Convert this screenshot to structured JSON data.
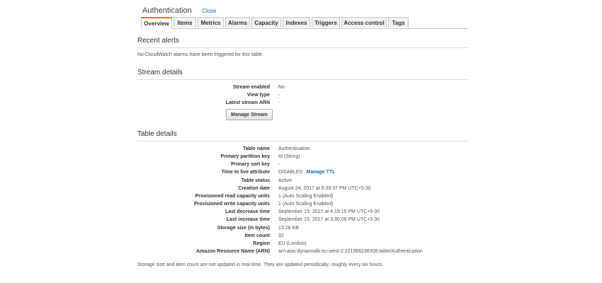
{
  "header": {
    "title": "Authentication",
    "close_label": "Close"
  },
  "tabs": [
    {
      "label": "Overview"
    },
    {
      "label": "Items"
    },
    {
      "label": "Metrics"
    },
    {
      "label": "Alarms"
    },
    {
      "label": "Capacity"
    },
    {
      "label": "Indexes"
    },
    {
      "label": "Triggers"
    },
    {
      "label": "Access control"
    },
    {
      "label": "Tags"
    }
  ],
  "recent_alerts": {
    "title": "Recent alerts",
    "message": "No CloudWatch alarms have been triggered for this table."
  },
  "stream_details": {
    "title": "Stream details",
    "rows": [
      {
        "label": "Stream enabled",
        "value": "No"
      },
      {
        "label": "View type",
        "value": "-"
      },
      {
        "label": "Latest stream ARN",
        "value": "-"
      }
    ],
    "manage_button": "Manage Stream"
  },
  "table_details": {
    "title": "Table details",
    "rows": [
      {
        "label": "Table name",
        "value": "Authentication"
      },
      {
        "label": "Primary partition key",
        "value": "Id (String)"
      },
      {
        "label": "Primary sort key",
        "value": "-"
      },
      {
        "label": "Time to live attribute",
        "value": "DISABLED",
        "link": "Manage TTL"
      },
      {
        "label": "Table status",
        "value": "Active"
      },
      {
        "label": "Creation date",
        "value": "August 24, 2017 at 6:39:37 PM UTC+5:30"
      },
      {
        "label": "Provisioned read capacity units",
        "value": "1 (Auto Scaling Enabled)"
      },
      {
        "label": "Provisioned write capacity units",
        "value": "1 (Auto Scaling Enabled)"
      },
      {
        "label": "Last decrease time",
        "value": "September 15, 2017 at 4:19:15 PM UTC+5:30"
      },
      {
        "label": "Last increase time",
        "value": "September 15, 2017 at 3:30:09 PM UTC+5:30"
      },
      {
        "label": "Storage size (in bytes)",
        "value": "13.28 KB"
      },
      {
        "label": "Item count",
        "value": "32"
      },
      {
        "label": "Region",
        "value": "EU (London)"
      },
      {
        "label": "Amazon Resource Name (ARN)",
        "value": "arn:aws:dynamodb:eu-west-2:221966236306:table/Authentication"
      }
    ],
    "footnote": "Storage size and item count are not updated in real-time. They are updated periodically, roughly every six hours."
  },
  "colors": {
    "accent": "#e47911",
    "link": "#1a6dbd"
  }
}
